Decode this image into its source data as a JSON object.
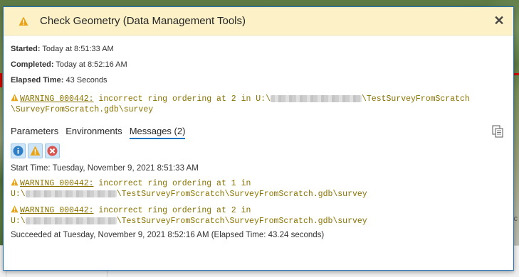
{
  "dialog": {
    "title": "Check Geometry (Data Management Tools)",
    "close_glyph": "✕",
    "started_label": "Started:",
    "started_value": "Today at 8:51:33 AM",
    "completed_label": "Completed:",
    "completed_value": "Today at 8:52:16 AM",
    "elapsed_label": "Elapsed Time:",
    "elapsed_value": "43 Seconds",
    "summary_warning": {
      "code": "WARNING 000442:",
      "text": " incorrect ring ordering at 2 in U:\\",
      "path_after": "\\TestSurveyFromScratch",
      "path_line2": "\\SurveyFromScratch.gdb\\survey"
    },
    "tabs": [
      "Parameters",
      "Environments",
      "Messages (2)"
    ],
    "active_tab": 2,
    "messages": {
      "start": "Start Time: Tuesday, November 9, 2021 8:51:33 AM",
      "warnings": [
        {
          "code": "WARNING 000442:",
          "text": " incorrect ring ordering at 1 in",
          "line2_prefix": "U:\\",
          "line2_suffix": "\\TestSurveyFromScratch\\SurveyFromScratch.gdb\\survey"
        },
        {
          "code": "WARNING 000442:",
          "text": " incorrect ring ordering at 2 in",
          "line2_prefix": "U:\\",
          "line2_suffix": "\\TestSurveyFromScratch\\SurveyFromScratch.gdb\\survey"
        }
      ],
      "succeeded": "Succeeded at Tuesday, November 9, 2021 8:52:16 AM (Elapsed Time: 43.24 seconds)"
    },
    "icons": {
      "title": "warning-icon",
      "copy": "copy-icon",
      "filters": [
        "info-filter-icon",
        "warning-filter-icon",
        "error-filter-icon"
      ]
    }
  },
  "background": {
    "edge_text": "c"
  },
  "colors": {
    "title_bar": "#fdf1c8",
    "accent": "#1e73be",
    "warning_text": "#8a7200",
    "warning_icon": "#e8a317",
    "error_icon": "#d9534f"
  }
}
